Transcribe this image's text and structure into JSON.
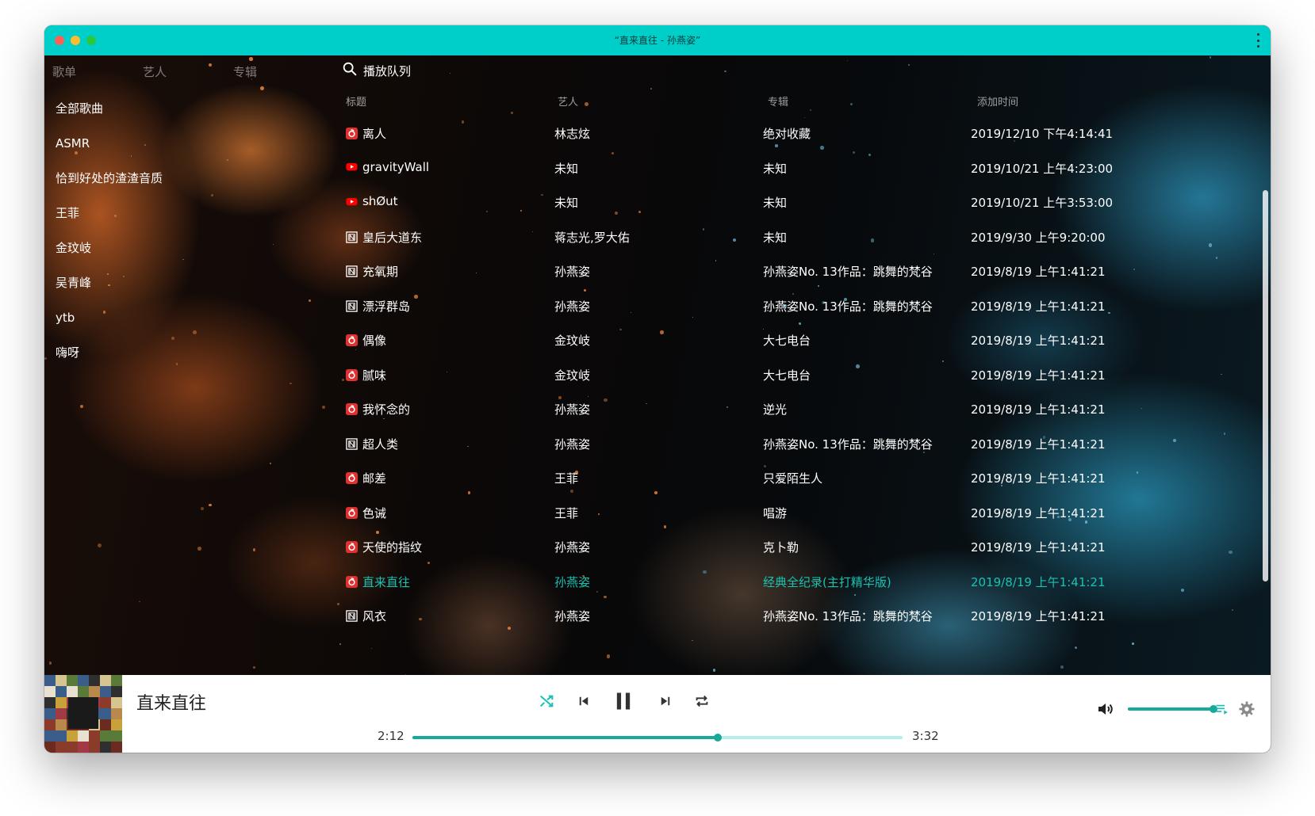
{
  "window": {
    "title": "“直来直往 - 孙燕姿”"
  },
  "colors": {
    "titlebar": "#00cec9",
    "accent": "#19c2b2",
    "progress": "#18a99c"
  },
  "tabs": [
    {
      "label": "歌单"
    },
    {
      "label": "艺人"
    },
    {
      "label": "专辑"
    }
  ],
  "queue_label": "播放队列",
  "sidebar": {
    "items": [
      {
        "label": "全部歌曲"
      },
      {
        "label": "ASMR"
      },
      {
        "label": "恰到好处的渣渣音质"
      },
      {
        "label": "王菲"
      },
      {
        "label": "金玟岐"
      },
      {
        "label": "吴青峰"
      },
      {
        "label": "ytb"
      },
      {
        "label": "嗨呀"
      }
    ]
  },
  "table": {
    "columns": [
      "标题",
      "艺人",
      "专辑",
      "添加时间"
    ],
    "rows": [
      {
        "source": "netease-icon",
        "title": "离人",
        "artist": "林志炫",
        "album": "绝对收藏",
        "added": "2019/12/10 下午4:14:41"
      },
      {
        "source": "youtube-icon",
        "title": "gravityWall",
        "artist": "未知",
        "album": "未知",
        "added": "2019/10/21 上午4:23:00"
      },
      {
        "source": "youtube-icon",
        "title": "shØut",
        "artist": "未知",
        "album": "未知",
        "added": "2019/10/21 上午3:53:00"
      },
      {
        "source": "local-file-icon",
        "title": "皇后大道东",
        "artist": "蒋志光,罗大佑",
        "album": "未知",
        "added": "2019/9/30 上午9:20:00"
      },
      {
        "source": "local-file-icon",
        "title": "充氧期",
        "artist": "孙燕姿",
        "album": "孙燕姿No. 13作品：跳舞的梵谷",
        "added": "2019/8/19 上午1:41:21"
      },
      {
        "source": "local-file-icon",
        "title": "漂浮群岛",
        "artist": "孙燕姿",
        "album": "孙燕姿No. 13作品：跳舞的梵谷",
        "added": "2019/8/19 上午1:41:21"
      },
      {
        "source": "netease-icon",
        "title": "偶像",
        "artist": "金玟岐",
        "album": "大七电台",
        "added": "2019/8/19 上午1:41:21"
      },
      {
        "source": "netease-icon",
        "title": "腻味",
        "artist": "金玟岐",
        "album": "大七电台",
        "added": "2019/8/19 上午1:41:21"
      },
      {
        "source": "netease-icon",
        "title": "我怀念的",
        "artist": "孙燕姿",
        "album": "逆光",
        "added": "2019/8/19 上午1:41:21"
      },
      {
        "source": "local-file-icon",
        "title": "超人类",
        "artist": "孙燕姿",
        "album": "孙燕姿No. 13作品：跳舞的梵谷",
        "added": "2019/8/19 上午1:41:21"
      },
      {
        "source": "netease-icon",
        "title": "邮差",
        "artist": "王菲",
        "album": "只爱陌生人",
        "added": "2019/8/19 上午1:41:21"
      },
      {
        "source": "netease-icon",
        "title": "色诫",
        "artist": "王菲",
        "album": "唱游",
        "added": "2019/8/19 上午1:41:21"
      },
      {
        "source": "netease-icon",
        "title": "天使的指纹",
        "artist": "孙燕姿",
        "album": "克卜勒",
        "added": "2019/8/19 上午1:41:21"
      },
      {
        "source": "netease-icon",
        "title": "直来直往",
        "artist": "孙燕姿",
        "album": "经典全纪录(主打精华版)",
        "added": "2019/8/19 上午1:41:21",
        "active": true
      },
      {
        "source": "local-file-icon",
        "title": "风衣",
        "artist": "孙燕姿",
        "album": "孙燕姿No. 13作品：跳舞的梵谷",
        "added": "2019/8/19 上午1:41:21"
      }
    ]
  },
  "player": {
    "title": "直来直往",
    "current_time": "2:12",
    "duration": "3:32",
    "progress": 0.623,
    "volume": 1.0,
    "controls": [
      "shuffle-icon",
      "previous-icon",
      "pause-icon",
      "next-icon",
      "repeat-icon"
    ],
    "right_icons": [
      "volume-icon",
      "playlist-icon",
      "settings-gear-icon"
    ]
  }
}
